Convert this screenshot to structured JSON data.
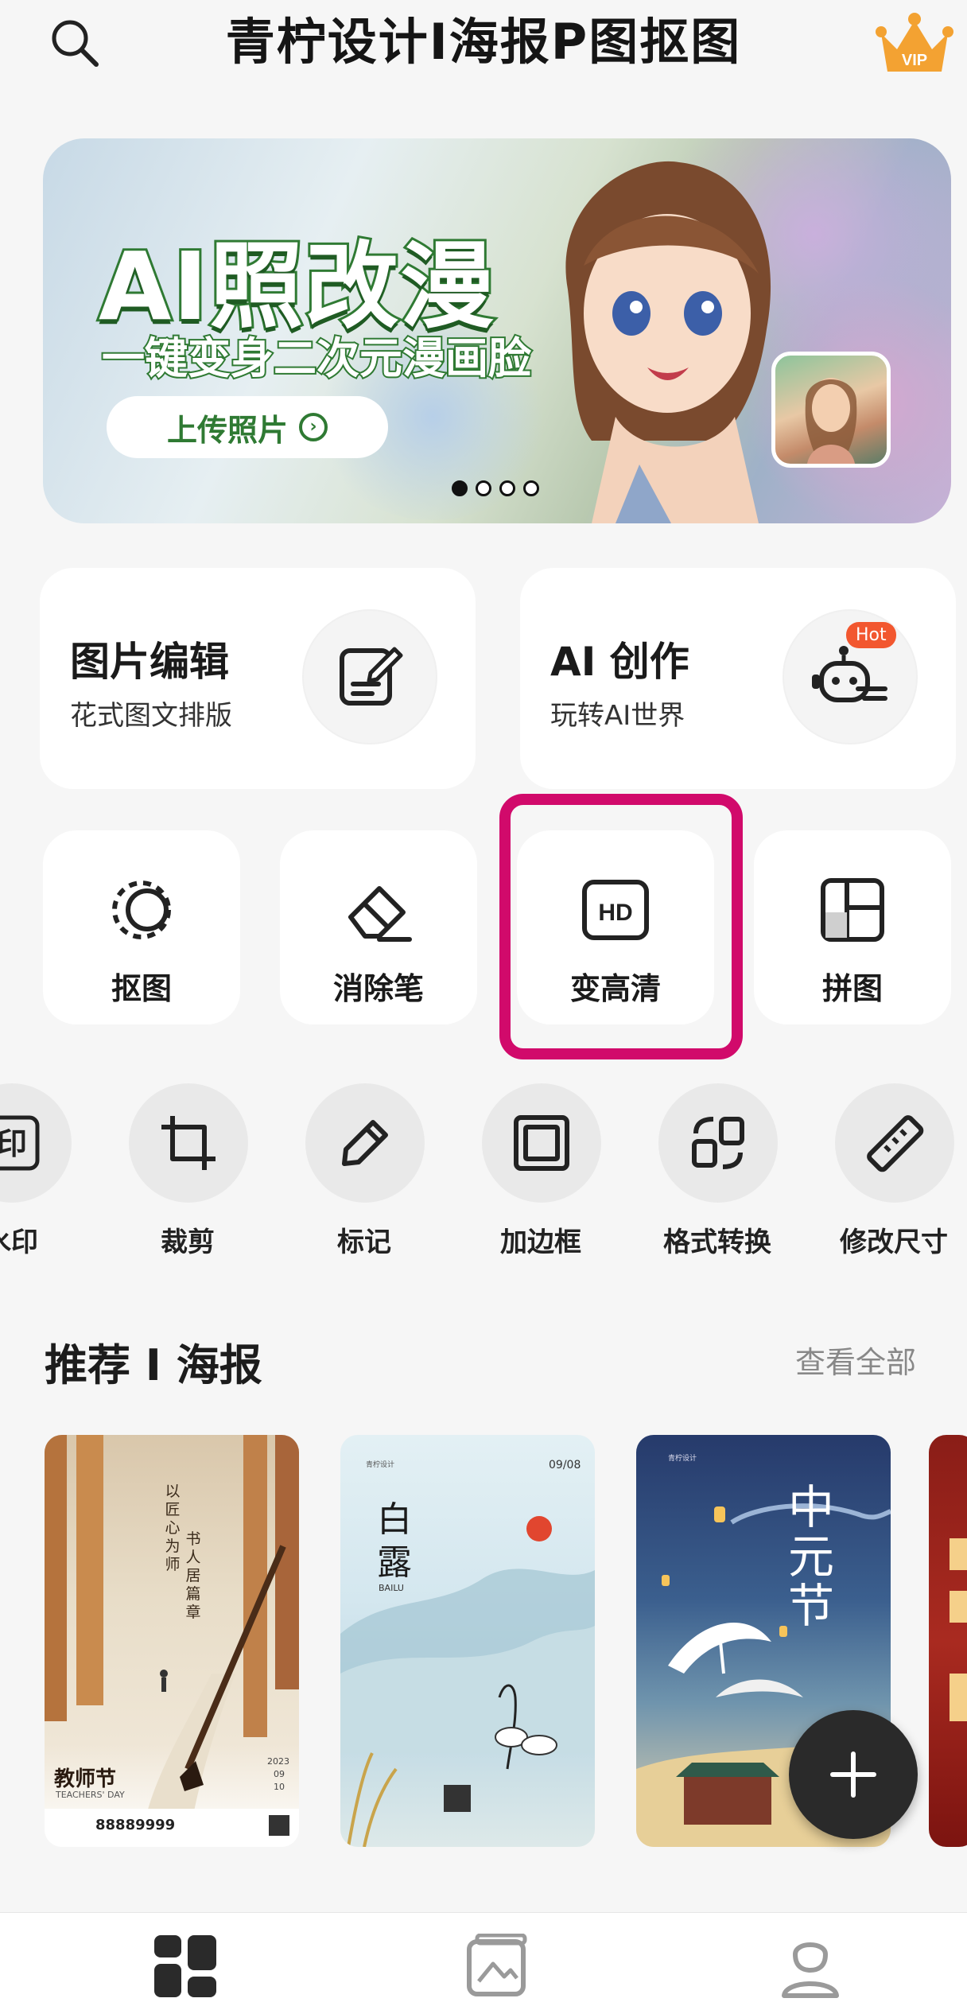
{
  "header": {
    "title": "青柠设计I海报P图抠图",
    "vip_label": "VIP"
  },
  "banner": {
    "title": "AI照改漫",
    "subtitle": "一键变身二次元漫画脸",
    "button_label": "上传照片",
    "page_count": 4,
    "active_page": 1
  },
  "features": [
    {
      "title": "图片编辑",
      "subtitle": "花式图文排版",
      "icon": "edit-icon"
    },
    {
      "title": "AI 创作",
      "subtitle": "玩转AI世界",
      "icon": "robot-icon",
      "badge": "Hot"
    }
  ],
  "tools": [
    {
      "label": "抠图",
      "icon": "cutout-icon"
    },
    {
      "label": "消除笔",
      "icon": "eraser-icon"
    },
    {
      "label": "变高清",
      "icon": "hd-icon",
      "highlighted": true
    },
    {
      "label": "拼图",
      "icon": "collage-icon"
    }
  ],
  "small_tools": [
    {
      "label": "水印",
      "icon": "watermark-icon",
      "icon_text": "印"
    },
    {
      "label": "裁剪",
      "icon": "crop-icon"
    },
    {
      "label": "标记",
      "icon": "pen-icon"
    },
    {
      "label": "加边框",
      "icon": "frame-icon"
    },
    {
      "label": "格式转换",
      "icon": "convert-icon"
    },
    {
      "label": "修改尺寸",
      "icon": "ruler-icon"
    }
  ],
  "hd_icon_text": "HD",
  "section": {
    "title": "推荐 I 海报",
    "view_all": "查看全部"
  },
  "posters": [
    {
      "name": "teachers-day",
      "lines": [
        "以",
        "匠",
        "心",
        "为",
        "师",
        "书",
        "人",
        "居",
        "篇",
        "章"
      ],
      "title": "教师节",
      "subtitle": "TEACHERS' DAY",
      "year": "2023",
      "month": "09",
      "day": "10",
      "phone": "88889999"
    },
    {
      "name": "bailu",
      "title_1": "白",
      "title_2": "露",
      "latin": "BAILU",
      "date": "09/08",
      "brand": "青柠设计"
    },
    {
      "name": "zhongyuan",
      "title": "中元节",
      "brand": "青柠设计"
    },
    {
      "name": "partial-red"
    }
  ],
  "tabs": [
    {
      "name": "home-tab",
      "icon": "dashboard-icon",
      "active": true
    },
    {
      "name": "gallery-tab",
      "icon": "gallery-icon",
      "active": false
    },
    {
      "name": "profile-tab",
      "icon": "user-icon",
      "active": false
    }
  ],
  "colors": {
    "accent_highlight": "#d10a6b",
    "banner_green": "#2f7a33",
    "hot_badge": "#f2572f",
    "fab": "#2a2a2a"
  }
}
